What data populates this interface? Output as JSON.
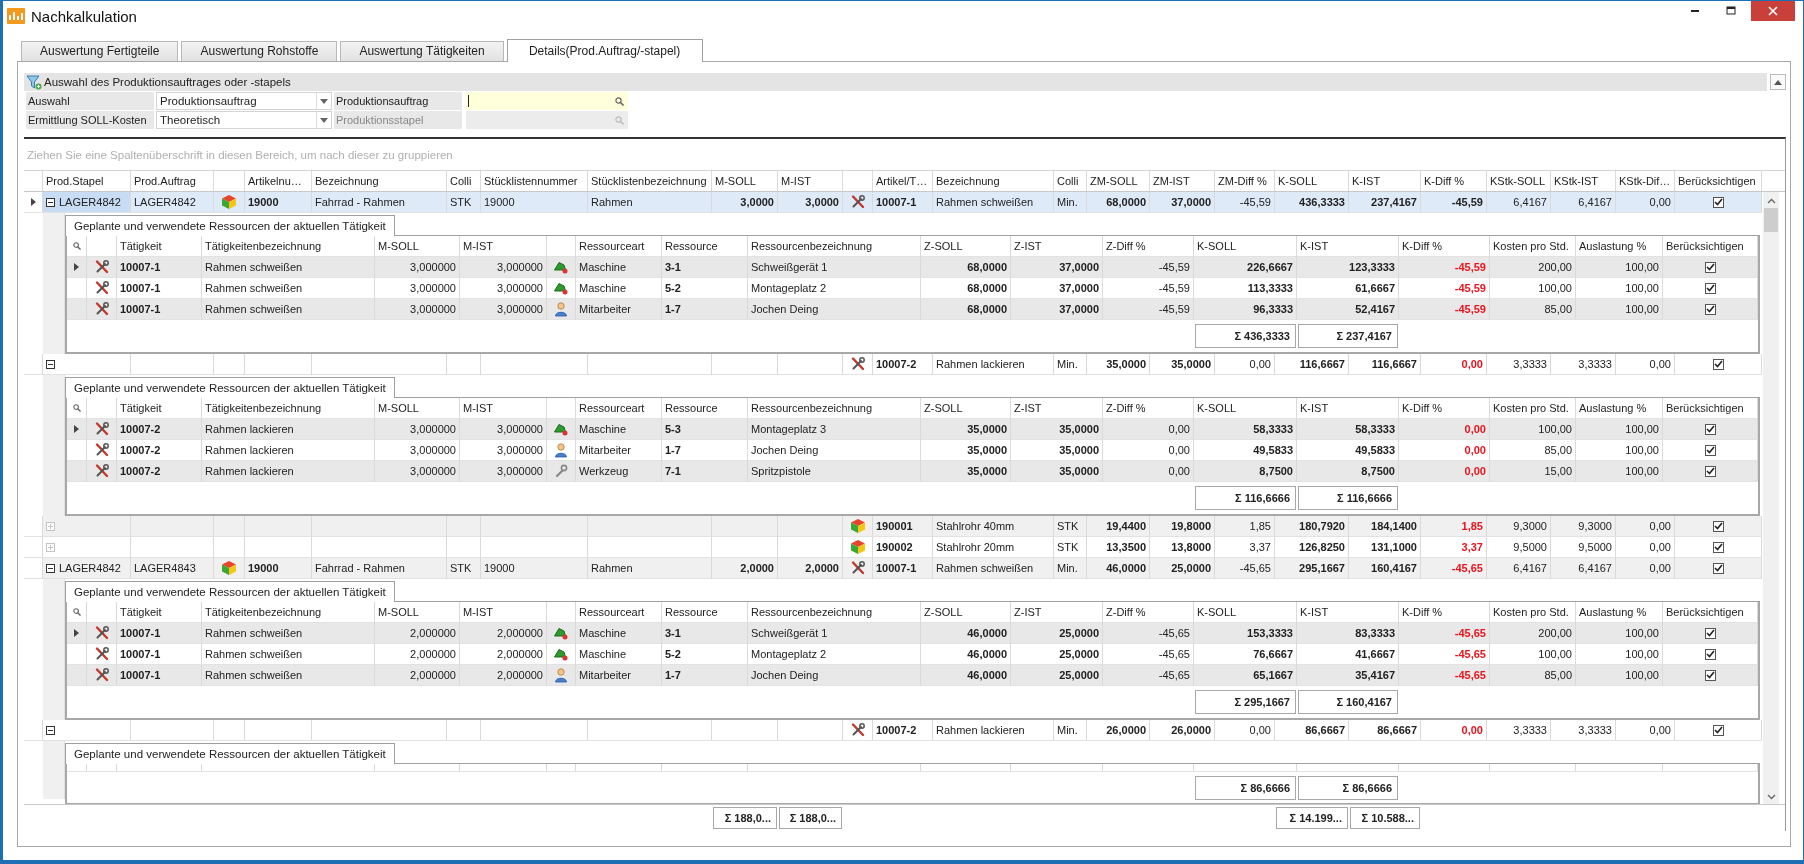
{
  "window": {
    "title": "Nachkalkulation"
  },
  "tabs": [
    {
      "label": "Auswertung Fertigteile",
      "selected": false
    },
    {
      "label": "Auswertung Rohstoffe",
      "selected": false
    },
    {
      "label": "Auswertung Tätigkeiten",
      "selected": false
    },
    {
      "label": "Details(Prod.Auftrag/-stapel)",
      "selected": true
    }
  ],
  "selection": {
    "title": "Auswahl des Produktionsauftrages oder -stapels",
    "fields": [
      {
        "label": "Auswahl",
        "value": "Produktionsauftrag"
      },
      {
        "label": "Ermittlung SOLL-Kosten",
        "value": "Theoretisch"
      }
    ],
    "lookups": [
      {
        "label": "Produktionsauftrag",
        "disabled": false
      },
      {
        "label": "Produktionsstapel",
        "disabled": true
      }
    ]
  },
  "group_hint": "Ziehen Sie eine Spaltenüberschrift in diesen Bereich, um nach dieser zu gruppieren",
  "grid": {
    "columns": [
      "Prod.Stapel",
      "Prod.Auftrag",
      "Artikelnu…",
      "Bezeichnung",
      "Colli",
      "Stücklistennummer",
      "Stücklistenbezeichnung",
      "M-SOLL",
      "M-IST",
      "Artikel/T…",
      "Bezeichnung",
      "Colli",
      "ZM-SOLL",
      "ZM-IST",
      "ZM-Diff %",
      "K-SOLL",
      "K-IST",
      "K-Diff %",
      "KStk-SOLL",
      "KStk-IST",
      "KStk-Dif…",
      "Berücksichtigen"
    ],
    "rows": [
      {
        "kind": "order",
        "selected": true,
        "expanded": true,
        "checked": true,
        "cells": [
          "LAGER4842",
          "LAGER4842",
          "19000",
          "Fahrrad - Rahmen",
          "STK",
          "19000",
          "Rahmen",
          "3,0000",
          "3,0000",
          "10007-1",
          "Rahmen schweißen",
          "Min.",
          "68,0000",
          "37,0000",
          "-45,59",
          "436,3333",
          "237,4167",
          "-45,59",
          "6,4167",
          "6,4167",
          "0,00"
        ],
        "detail": {
          "title": "Geplante und verwendete Ressourcen der aktuellen Tätigkeit",
          "columns": [
            "Tätigkeit",
            "Tätigkeitenbezeichnung",
            "M-SOLL",
            "M-IST",
            "Ressourceart",
            "Ressource",
            "Ressourcenbezeichnung",
            "Z-SOLL",
            "Z-IST",
            "Z-Diff %",
            "K-SOLL",
            "K-IST",
            "K-Diff %",
            "Kosten pro Std.",
            "Auslastung %",
            "Berücksichtigen"
          ],
          "rows": [
            {
              "kind": "machine",
              "selected": true,
              "checked": true,
              "cells": [
                "10007-1",
                "Rahmen schweißen",
                "3,000000",
                "3,000000",
                "Maschine",
                "3-1",
                "Schweißgerät 1",
                "68,0000",
                "37,0000",
                "-45,59",
                "226,6667",
                "123,3333",
                "-45,59",
                "200,00",
                "100,00"
              ]
            },
            {
              "kind": "machine",
              "selected": false,
              "checked": true,
              "cells": [
                "10007-1",
                "Rahmen schweißen",
                "3,000000",
                "3,000000",
                "Maschine",
                "5-2",
                "Montageplatz 2",
                "68,0000",
                "37,0000",
                "-45,59",
                "113,3333",
                "61,6667",
                "-45,59",
                "100,00",
                "100,00"
              ]
            },
            {
              "kind": "person",
              "selected": false,
              "checked": true,
              "cells": [
                "10007-1",
                "Rahmen schweißen",
                "3,000000",
                "3,000000",
                "Mitarbeiter",
                "1-7",
                "Jochen Deing",
                "68,0000",
                "37,0000",
                "-45,59",
                "96,3333",
                "52,4167",
                "-45,59",
                "85,00",
                "100,00"
              ]
            }
          ],
          "sums": [
            "Σ 436,3333",
            "Σ 237,4167"
          ]
        }
      },
      {
        "kind": "activity",
        "selected": false,
        "expanded": true,
        "checked": true,
        "cells": [
          null,
          null,
          null,
          null,
          null,
          null,
          null,
          null,
          null,
          "10007-2",
          "Rahmen lackieren",
          "Min.",
          "35,0000",
          "35,0000",
          "0,00",
          "116,6667",
          "116,6667",
          "0,00",
          "3,3333",
          "3,3333",
          "0,00"
        ],
        "detail": {
          "title": "Geplante und verwendete Ressourcen der aktuellen Tätigkeit",
          "columns": [
            "Tätigkeit",
            "Tätigkeitenbezeichnung",
            "M-SOLL",
            "M-IST",
            "Ressourceart",
            "Ressource",
            "Ressourcenbezeichnung",
            "Z-SOLL",
            "Z-IST",
            "Z-Diff %",
            "K-SOLL",
            "K-IST",
            "K-Diff %",
            "Kosten pro Std.",
            "Auslastung %",
            "Berücksichtigen"
          ],
          "rows": [
            {
              "kind": "machine",
              "selected": true,
              "checked": true,
              "cells": [
                "10007-2",
                "Rahmen lackieren",
                "3,000000",
                "3,000000",
                "Maschine",
                "5-3",
                "Montageplatz 3",
                "35,0000",
                "35,0000",
                "0,00",
                "58,3333",
                "58,3333",
                "0,00",
                "100,00",
                "100,00"
              ]
            },
            {
              "kind": "person",
              "selected": false,
              "checked": true,
              "cells": [
                "10007-2",
                "Rahmen lackieren",
                "3,000000",
                "3,000000",
                "Mitarbeiter",
                "1-7",
                "Jochen Deing",
                "35,0000",
                "35,0000",
                "0,00",
                "49,5833",
                "49,5833",
                "0,00",
                "85,00",
                "100,00"
              ]
            },
            {
              "kind": "tool",
              "selected": false,
              "checked": true,
              "cells": [
                "10007-2",
                "Rahmen lackieren",
                "3,000000",
                "3,000000",
                "Werkzeug",
                "7-1",
                "Spritzpistole",
                "35,0000",
                "35,0000",
                "0,00",
                "8,7500",
                "8,7500",
                "0,00",
                "15,00",
                "100,00"
              ]
            }
          ],
          "sums": [
            "Σ 116,6666",
            "Σ 116,6666"
          ]
        }
      },
      {
        "kind": "material",
        "selected": false,
        "expanded": false,
        "checked": true,
        "cells": [
          null,
          null,
          null,
          null,
          null,
          null,
          null,
          null,
          null,
          "190001",
          "Stahlrohr 40mm",
          "STK",
          "19,4400",
          "19,8000",
          "1,85",
          "180,7920",
          "184,1400",
          "1,85",
          "9,3000",
          "9,3000",
          "0,00"
        ]
      },
      {
        "kind": "material",
        "selected": false,
        "expanded": false,
        "checked": true,
        "cells": [
          null,
          null,
          null,
          null,
          null,
          null,
          null,
          null,
          null,
          "190002",
          "Stahlrohr 20mm",
          "STK",
          "13,3500",
          "13,8000",
          "3,37",
          "126,8250",
          "131,1000",
          "3,37",
          "9,5000",
          "9,5000",
          "0,00"
        ]
      },
      {
        "kind": "order",
        "selected": false,
        "expanded": true,
        "checked": true,
        "cells": [
          "LAGER4842",
          "LAGER4843",
          "19000",
          "Fahrrad - Rahmen",
          "STK",
          "19000",
          "Rahmen",
          "2,0000",
          "2,0000",
          "10007-1",
          "Rahmen schweißen",
          "Min.",
          "46,0000",
          "25,0000",
          "-45,65",
          "295,1667",
          "160,4167",
          "-45,65",
          "6,4167",
          "6,4167",
          "0,00"
        ],
        "detail": {
          "title": "Geplante und verwendete Ressourcen der aktuellen Tätigkeit",
          "columns": [
            "Tätigkeit",
            "Tätigkeitenbezeichnung",
            "M-SOLL",
            "M-IST",
            "Ressourceart",
            "Ressource",
            "Ressourcenbezeichnung",
            "Z-SOLL",
            "Z-IST",
            "Z-Diff %",
            "K-SOLL",
            "K-IST",
            "K-Diff %",
            "Kosten pro Std.",
            "Auslastung %",
            "Berücksichtigen"
          ],
          "rows": [
            {
              "kind": "machine",
              "selected": true,
              "checked": true,
              "cells": [
                "10007-1",
                "Rahmen schweißen",
                "2,000000",
                "2,000000",
                "Maschine",
                "3-1",
                "Schweißgerät 1",
                "46,0000",
                "25,0000",
                "-45,65",
                "153,3333",
                "83,3333",
                "-45,65",
                "200,00",
                "100,00"
              ]
            },
            {
              "kind": "machine",
              "selected": false,
              "checked": true,
              "cells": [
                "10007-1",
                "Rahmen schweißen",
                "2,000000",
                "2,000000",
                "Maschine",
                "5-2",
                "Montageplatz 2",
                "46,0000",
                "25,0000",
                "-45,65",
                "76,6667",
                "41,6667",
                "-45,65",
                "100,00",
                "100,00"
              ]
            },
            {
              "kind": "person",
              "selected": false,
              "checked": true,
              "cells": [
                "10007-1",
                "Rahmen schweißen",
                "2,000000",
                "2,000000",
                "Mitarbeiter",
                "1-7",
                "Jochen Deing",
                "46,0000",
                "25,0000",
                "-45,65",
                "65,1667",
                "35,4167",
                "-45,65",
                "85,00",
                "100,00"
              ]
            }
          ],
          "sums": [
            "Σ 295,1667",
            "Σ 160,4167"
          ]
        }
      },
      {
        "kind": "activity",
        "selected": false,
        "expanded": true,
        "checked": true,
        "cells": [
          null,
          null,
          null,
          null,
          null,
          null,
          null,
          null,
          null,
          "10007-2",
          "Rahmen lackieren",
          "Min.",
          "26,0000",
          "26,0000",
          "0,00",
          "86,6667",
          "86,6667",
          "0,00",
          "3,3333",
          "3,3333",
          "0,00"
        ],
        "detail": {
          "title": "Geplante und verwendete Ressourcen der aktuellen Tätigkeit",
          "sums": [
            "Σ 86,6666",
            "Σ 86,6666"
          ]
        }
      }
    ],
    "footer_sums": [
      "Σ 188,0...",
      "Σ 188,0...",
      "Σ 14.199...",
      "Σ 10.588..."
    ]
  }
}
